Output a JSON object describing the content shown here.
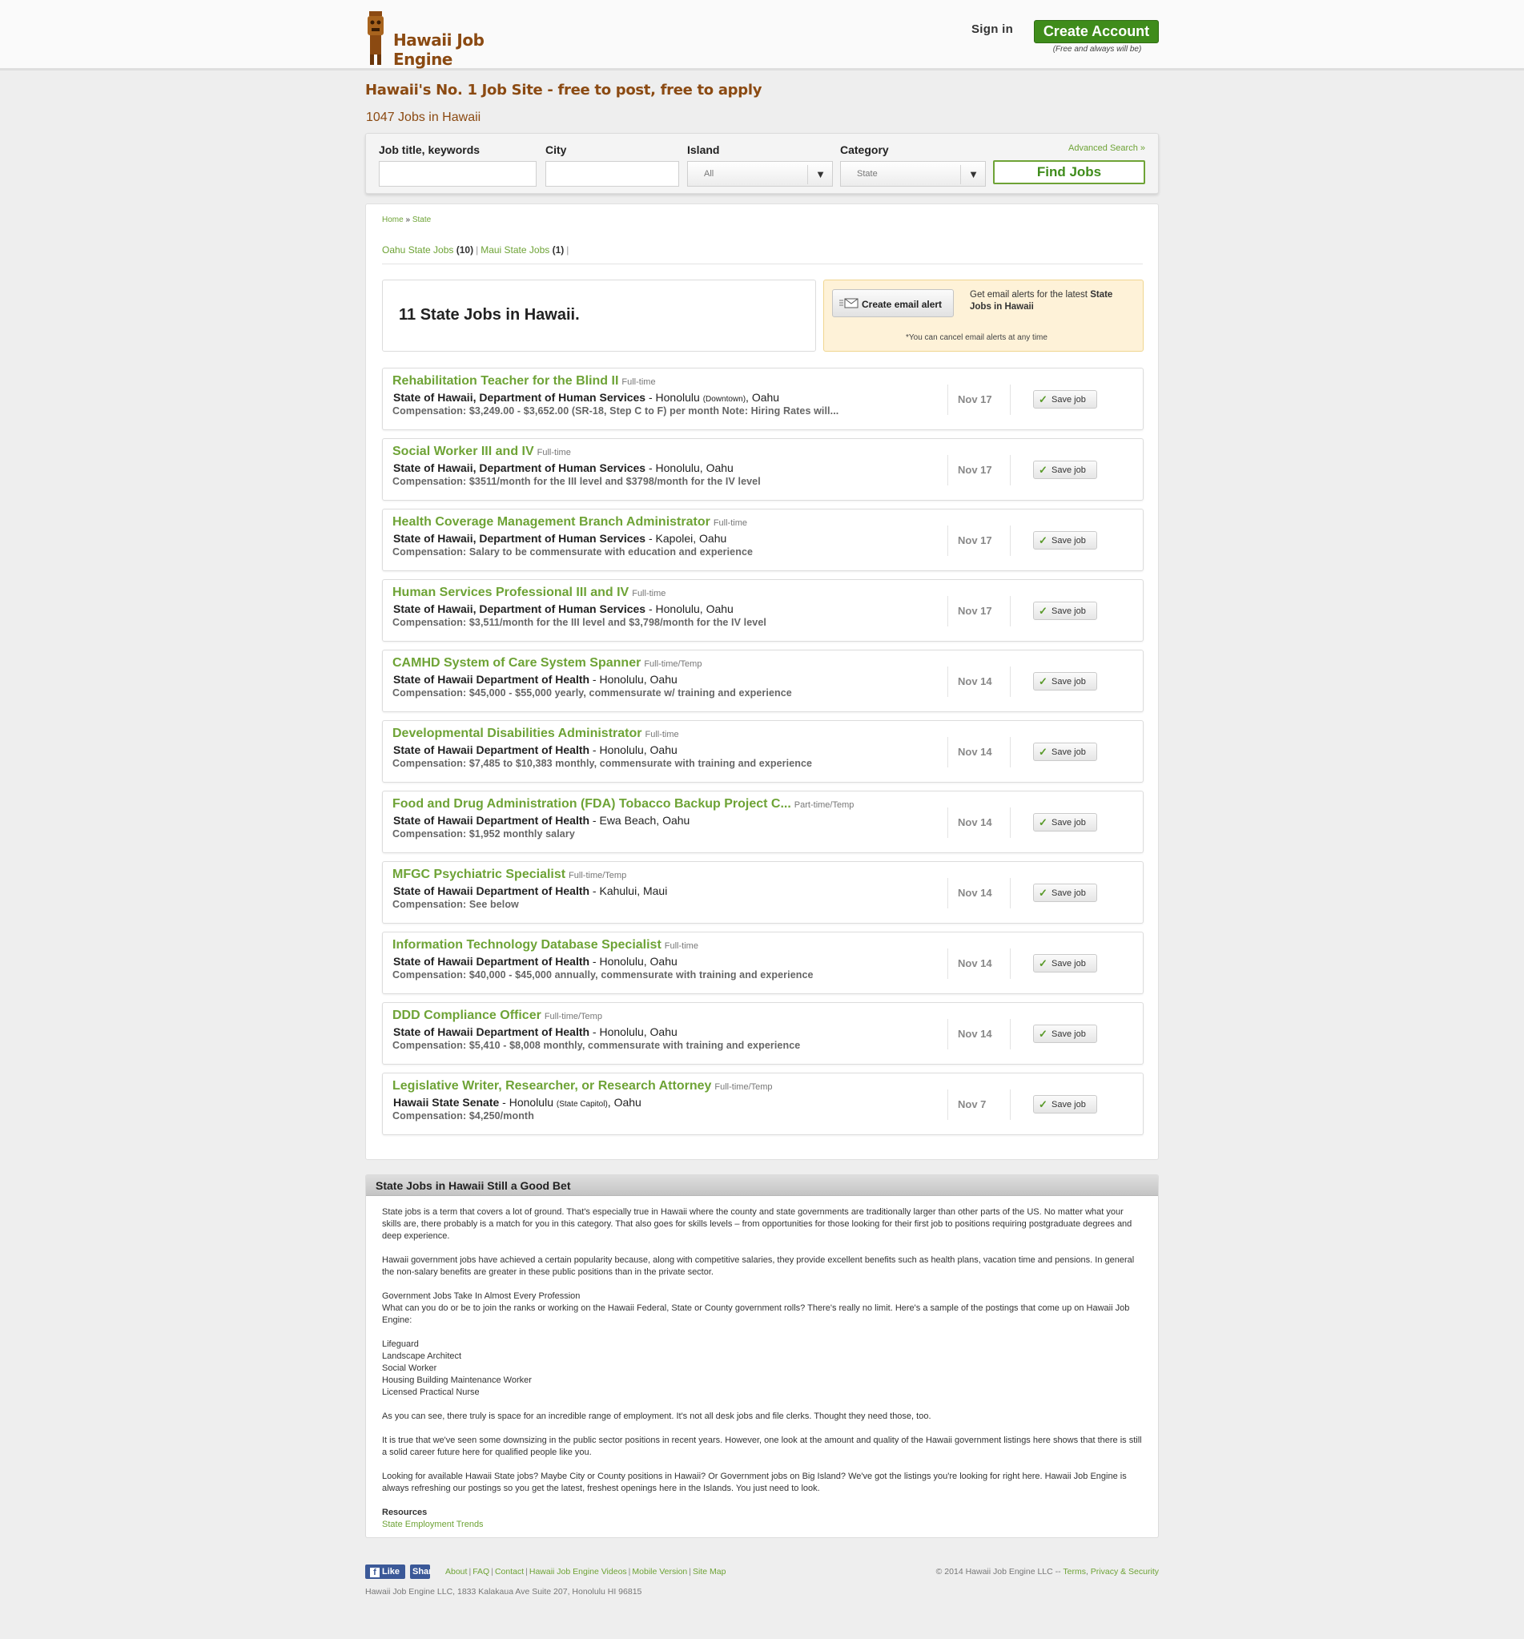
{
  "header": {
    "logo_text": "Hawaii Job Engine",
    "sign_in": "Sign in",
    "create_account": "Create Account",
    "create_note": "(Free and always will be)"
  },
  "tagline": "Hawaii's No. 1 Job Site - free to post, free to apply",
  "job_count": "1047 Jobs in Hawaii",
  "search": {
    "keywords_label": "Job title, keywords",
    "city_label": "City",
    "island_label": "Island",
    "island_value": "All",
    "category_label": "Category",
    "category_value": "State",
    "advanced": "Advanced Search »",
    "find_button": "Find Jobs"
  },
  "breadcrumb": {
    "home": "Home",
    "sep": "»",
    "current": "State"
  },
  "islands": [
    {
      "label": "Oahu State Jobs",
      "count": "(10)"
    },
    {
      "label": "Maui State Jobs",
      "count": "(1)"
    }
  ],
  "results_title": "11 State Jobs in Hawaii.",
  "alert": {
    "button": "Create email alert",
    "msg_prefix": "Get email alerts for the latest ",
    "msg_bold": "State Jobs in Hawaii",
    "note": "*You can cancel email alerts at any time"
  },
  "jobs": [
    {
      "title": "Rehabilitation Teacher for the Blind II",
      "type": "Full-time",
      "company": "State of Hawaii, Department of Human Services",
      "loc1": " - Honolulu ",
      "loc_small": "(Downtown)",
      "loc2": ", Oahu",
      "comp": "Compensation: $3,249.00 - $3,652.00 (SR-18, Step C to F) per month Note: Hiring Rates will...",
      "date": "Nov 17",
      "save": "Save job"
    },
    {
      "title": "Social Worker III and IV",
      "type": "Full-time",
      "company": "State of Hawaii, Department of Human Services",
      "loc1": " - Honolulu, Oahu",
      "loc_small": "",
      "loc2": "",
      "comp": "Compensation: $3511/month for the III level and $3798/month for the IV level",
      "date": "Nov 17",
      "save": "Save job"
    },
    {
      "title": "Health Coverage Management Branch Administrator",
      "type": "Full-time",
      "company": "State of Hawaii, Department of Human Services",
      "loc1": " - Kapolei, Oahu",
      "loc_small": "",
      "loc2": "",
      "comp": "Compensation: Salary to be commensurate with education and experience",
      "date": "Nov 17",
      "save": "Save job"
    },
    {
      "title": "Human Services Professional III and IV",
      "type": "Full-time",
      "company": "State of Hawaii, Department of Human Services",
      "loc1": " - Honolulu, Oahu",
      "loc_small": "",
      "loc2": "",
      "comp": "Compensation: $3,511/month for the III level and $3,798/month for the IV level",
      "date": "Nov 17",
      "save": "Save job"
    },
    {
      "title": "CAMHD System of Care System Spanner",
      "type": "Full-time/Temp",
      "company": "State of Hawaii Department of Health",
      "loc1": " - Honolulu, Oahu",
      "loc_small": "",
      "loc2": "",
      "comp": "Compensation: $45,000 - $55,000 yearly, commensurate w/ training and experience",
      "date": "Nov 14",
      "save": "Save job"
    },
    {
      "title": "Developmental Disabilities Administrator",
      "type": "Full-time",
      "company": "State of Hawaii Department of Health",
      "loc1": " - Honolulu, Oahu",
      "loc_small": "",
      "loc2": "",
      "comp": "Compensation: $7,485 to $10,383 monthly, commensurate with training and experience",
      "date": "Nov 14",
      "save": "Save job"
    },
    {
      "title": "Food and Drug Administration (FDA) Tobacco Backup Project C...",
      "type": "Part-time/Temp",
      "company": "State of Hawaii Department of Health",
      "loc1": " - Ewa Beach, Oahu",
      "loc_small": "",
      "loc2": "",
      "comp": "Compensation: $1,952 monthly salary",
      "date": "Nov 14",
      "save": "Save job"
    },
    {
      "title": "MFGC Psychiatric Specialist",
      "type": "Full-time/Temp",
      "company": "State of Hawaii Department of Health",
      "loc1": " - Kahului, Maui",
      "loc_small": "",
      "loc2": "",
      "comp": "Compensation: See below",
      "date": "Nov 14",
      "save": "Save job"
    },
    {
      "title": "Information Technology Database Specialist",
      "type": "Full-time",
      "company": "State of Hawaii Department of Health",
      "loc1": " - Honolulu, Oahu",
      "loc_small": "",
      "loc2": "",
      "comp": "Compensation: $40,000 - $45,000 annually, commensurate with training and experience",
      "date": "Nov 14",
      "save": "Save job"
    },
    {
      "title": "DDD Compliance Officer",
      "type": "Full-time/Temp",
      "company": "State of Hawaii Department of Health",
      "loc1": " - Honolulu, Oahu",
      "loc_small": "",
      "loc2": "",
      "comp": "Compensation: $5,410 - $8,008 monthly, commensurate with training and experience",
      "date": "Nov 14",
      "save": "Save job"
    },
    {
      "title": "Legislative Writer, Researcher, or Research Attorney",
      "type": "Full-time/Temp",
      "company": "Hawaii State Senate",
      "loc1": " - Honolulu ",
      "loc_small": "(State Capitol)",
      "loc2": ", Oahu",
      "comp": "Compensation: $4,250/month",
      "date": "Nov 7",
      "save": "Save job"
    }
  ],
  "article": {
    "heading": "State Jobs in Hawaii Still a Good Bet",
    "p1": "State jobs is a term that covers a lot of ground. That's especially true in Hawaii where the county and state governments are traditionally larger than other parts of the US. No matter what your skills are, there probably is a match for you in this category. That also goes for skills levels – from opportunities for those looking for their first job to positions requiring postgraduate degrees and deep experience.",
    "p2": "Hawaii government jobs have achieved a certain popularity because, along with competitive salaries, they provide excellent benefits such as health plans, vacation time and pensions. In general the non-salary benefits are greater in these public positions than in the private sector.",
    "p3a": "Government Jobs Take In Almost Every Profession",
    "p3b": "What can you do or be to join the ranks or working on the Hawaii Federal, State or County government rolls? There's really no limit. Here's a sample of the postings that come up on Hawaii Job Engine:",
    "list": [
      "Lifeguard",
      "Landscape Architect",
      "Social Worker",
      "Housing Building Maintenance Worker",
      "Licensed Practical Nurse"
    ],
    "p4": "As you can see, there truly is space for an incredible range of employment. It's not all desk jobs and file clerks. Thought they need those, too.",
    "p5": "It is true that we've seen some downsizing in the public sector positions in recent years. However, one look at the amount and quality of the Hawaii government listings here shows that there is still a solid career future here for qualified people like you.",
    "p6": "Looking for available Hawaii State jobs? Maybe City or County positions in Hawaii? Or Government jobs on Big Island? We've got the listings you're looking for right here. Hawaii Job Engine is always refreshing our postings so you get the latest, freshest openings here in the Islands. You just need to look.",
    "resources_label": "Resources",
    "resources_link": "State Employment Trends"
  },
  "footer": {
    "fb_like": "Like",
    "fb_share": "Share",
    "links": [
      "About",
      "FAQ",
      "Contact",
      "Hawaii Job Engine Videos",
      "Mobile Version",
      "Site Map"
    ],
    "copyright": "© 2014 Hawaii Job Engine LLC -- ",
    "terms": "Terms",
    "privacy": "Privacy & Security",
    "address": "Hawaii Job Engine LLC,  1833 Kalakaua Ave Suite 207,  Honolulu  HI  96815"
  },
  "colors": {
    "brand_brown": "#8b4a12",
    "accent_green": "#6ea336",
    "button_green": "#3f8c1b",
    "alert_bg": "#fef2d8"
  }
}
